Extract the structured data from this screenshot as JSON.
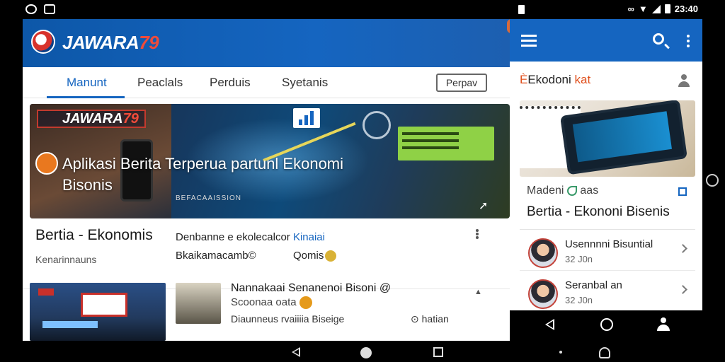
{
  "status_bar": {
    "time": "23:40"
  },
  "main_app": {
    "brand_text": "JAWARA",
    "brand_num": "79",
    "tabs": [
      {
        "label": "Manunt"
      },
      {
        "label": "Peaclals"
      },
      {
        "label": "Perduis"
      },
      {
        "label": "Syetanis"
      }
    ],
    "tab_button": "Perpav",
    "hero": {
      "brand_text": "JAWARA",
      "brand_num": "79",
      "headline": "Aplikasi Berita Terperua partunl Ekonomi Bisonis",
      "caption": "BEFACAAISSION"
    },
    "featured": {
      "title": "Bertia - Ekonomis",
      "subtitle": "Kenarinnauns",
      "col1_prefix": "Denbanne e ekolecalcor",
      "col1_highlight": "Kinaiai",
      "col2": "Bkaikamacamb©",
      "col3": "Qomis"
    },
    "article": {
      "title": "Nannakaai Senanenoi Bisoni @",
      "subtitle": "Scoonaa oata",
      "meta": "Diaunneus rvaiiiia Biseige",
      "meta2": "⊙ hatian"
    }
  },
  "side_app": {
    "category_prefix": "Ekodoni",
    "category_highlight": "kat",
    "meta": "Madeni",
    "meta_tag": "aas",
    "title": "Bertia - Ekononi Bisenis",
    "items": [
      {
        "title": "Usennnni Bisuntial",
        "sub": "32 J0n"
      },
      {
        "title": "Seranbal an",
        "sub": "32 J0n"
      }
    ]
  },
  "colors": {
    "accent": "#1565c0",
    "brand_red": "#f04b3a",
    "highlight_orange": "#e0501d"
  },
  "icons": [
    "menu-icon",
    "search-icon",
    "more-vert-icon",
    "user-icon",
    "chevron-right-icon",
    "back-icon",
    "home-icon",
    "recents-icon"
  ]
}
